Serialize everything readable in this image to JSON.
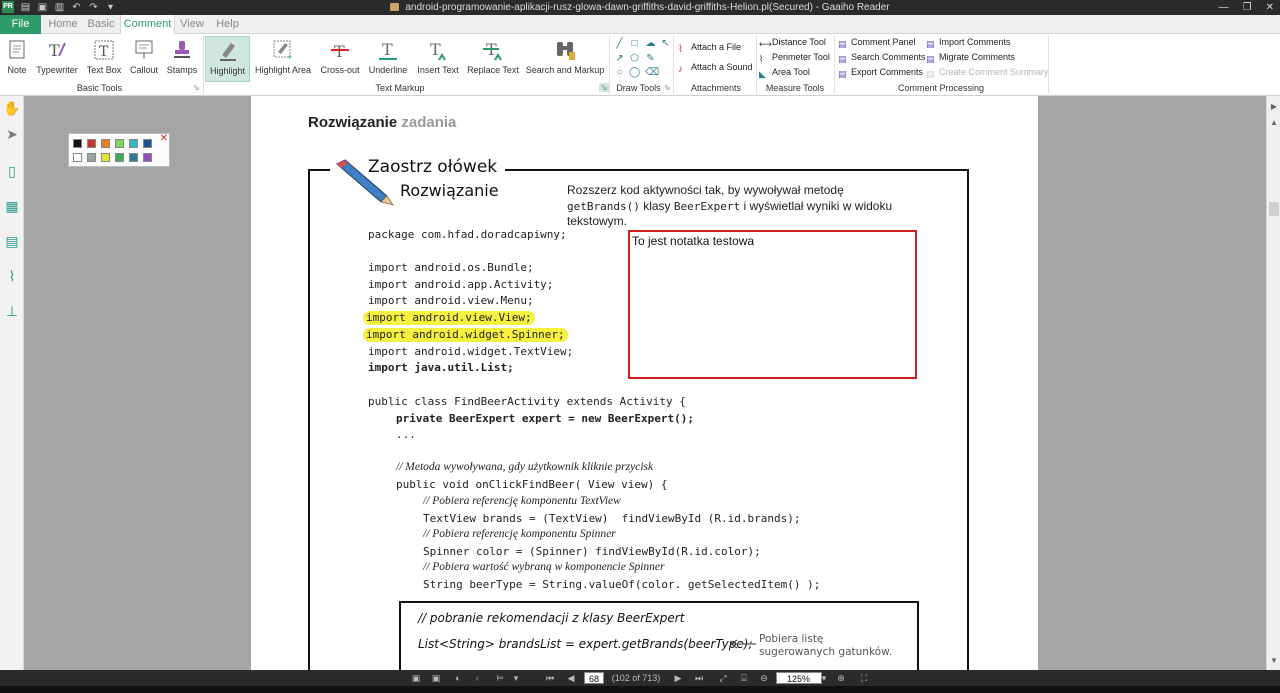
{
  "window": {
    "title": "android-programowanie-aplikacji-rusz-glowa-dawn-griffiths-david-griffiths-Helion.pl(Secured) - Gaaiho Reader",
    "app_logo": "PR"
  },
  "menu": {
    "file": "File",
    "home": "Home",
    "basic": "Basic",
    "comment": "Comment",
    "view": "View",
    "help": "Help"
  },
  "ribbon": {
    "basic_tools": {
      "group_label": "Basic Tools",
      "note": "Note",
      "typewriter": "Typewriter",
      "text_box": "Text Box",
      "callout": "Callout",
      "stamps": "Stamps"
    },
    "text_markup": {
      "group_label": "Text Markup",
      "highlight": "Highlight",
      "highlight_area": "Highlight Area",
      "cross_out": "Cross-out",
      "underline": "Underline",
      "insert_text": "Insert Text",
      "replace_text": "Replace Text",
      "search_and_markup": "Search and Markup"
    },
    "draw_tools": {
      "group_label": "Draw Tools"
    },
    "attachments": {
      "group_label": "Attachments",
      "attach_file": "Attach a File",
      "attach_sound": "Attach a Sound"
    },
    "measure_tools": {
      "group_label": "Measure Tools",
      "distance": "Distance Tool",
      "perimeter": "Perimeter Tool",
      "area": "Area Tool"
    },
    "comment_processing": {
      "group_label": "Comment Processing",
      "comment_panel": "Comment Panel",
      "search_comments": "Search Comments",
      "export_comments": "Export Comments",
      "import_comments": "Import Comments",
      "migrate_comments": "Migrate Comments",
      "create_summary": "Create Comment Summary"
    }
  },
  "colors": {
    "accent": "#2e9b6a",
    "highlight": "#f5f13e",
    "note_border": "#d21e1e"
  },
  "page": {
    "heading_bold": "Rozwiązanie",
    "heading_grey": "zadania",
    "zaostrz": "Zaostrz ołówek",
    "rozwiazanie": "Rozwiązanie",
    "intro_part1": "Rozszerz kod aktywności tak, by wywoływał metodę ",
    "intro_mono1": "getBrands()",
    "intro_part2": " klasy ",
    "intro_mono2": "BeerExpert",
    "intro_part3": " i wyświetlał wyniki w widoku tekstowym.",
    "code": {
      "package": "package com.hfad.doradcapiwny;",
      "imp1": "import android.os.Bundle;",
      "imp2": "import android.app.Activity;",
      "imp3": "import android.view.Menu;",
      "imp4": "import android.view.View;",
      "imp5": "import android.widget.Spinner;",
      "imp6": "import android.widget.TextView;",
      "imp7": "import java.util.List;",
      "class_decl": "public class FindBeerActivity extends Activity {",
      "expert": "private BeerExpert expert = new BeerExpert();",
      "dots": "...",
      "comment1": "// Metoda wywoływana, gdy użytkownik kliknie przycisk",
      "method": "public void onClickFindBeer( View view) {",
      "comment2": "// Pobiera referencję komponentu TextView",
      "brands": "TextView brands = (TextView)  findViewById (R.id.brands);",
      "comment3": "// Pobiera referencję komponentu Spinner",
      "color": "Spinner color = (Spinner) findViewById(R.id.color);",
      "comment4": "// Pobiera wartość wybraną w komponencie Spinner",
      "beertype": "String beerType = String.valueOf(color. getSelectedItem() );"
    },
    "note_text": "To jest notatka testowa",
    "box_comment": "// pobranie rekomendacji z klasy BeerExpert",
    "box_code": "List<String> brandsList = expert.getBrands(beerType);",
    "box_note1": "Pobiera listę",
    "box_note2": "sugerowanych gatunków."
  },
  "status": {
    "page_number": "68",
    "page_of": "(102 of 713)",
    "zoom": "125%"
  }
}
